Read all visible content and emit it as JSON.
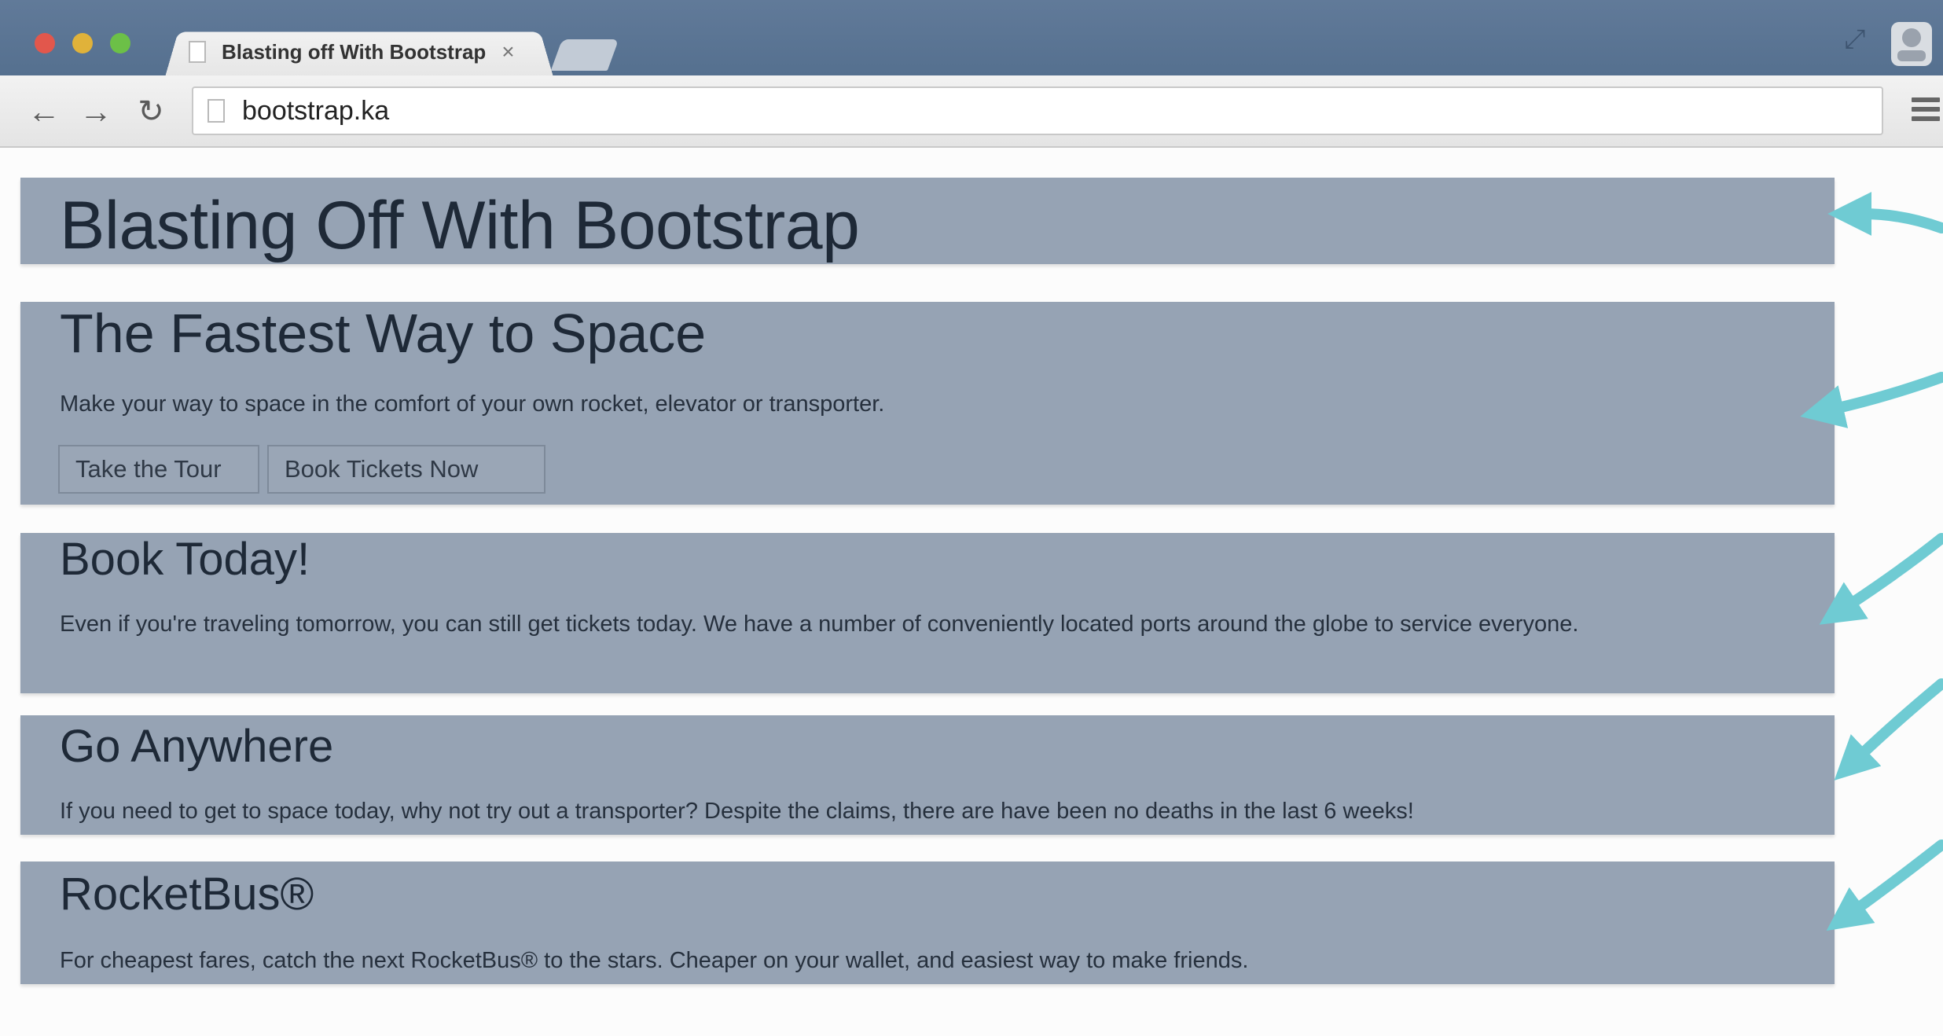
{
  "browser": {
    "tab_title": "Blasting off With Bootstrap",
    "tab_close": "×",
    "url": "bootstrap.ka",
    "icons": {
      "back": "back-arrow-icon",
      "forward": "forward-arrow-icon",
      "reload": "reload-icon",
      "menu": "hamburger-menu-icon",
      "expand": "expand-icon",
      "profile": "profile-icon"
    },
    "colors": {
      "tabbar": "#5c7594",
      "tab": "#ebebeb",
      "toolbar": "#ebebeb"
    }
  },
  "page": {
    "site_title": "Blasting Off With Bootstrap",
    "hero": {
      "heading": "The Fastest Way to Space",
      "text": "Make your way to space in the comfort of your own rocket, elevator or transporter.",
      "button_tour": "Take the Tour",
      "button_book": "Book Tickets Now"
    },
    "sections": [
      {
        "heading": "Book Today!",
        "text": "Even if you're traveling tomorrow, you can still get tickets today. We have a number of conveniently located ports around the globe to service everyone."
      },
      {
        "heading": "Go Anywhere",
        "text": "If you need to get to space today, why not try out a transporter? Despite the claims, there are have been no deaths in the last 6 weeks!"
      },
      {
        "heading": "RocketBus®",
        "text": "For cheapest fares, catch the next RocketBus® to the stars. Cheaper on your wallet, and easiest way to make friends."
      }
    ],
    "colors": {
      "box": "#96a3b4",
      "arrow": "#6fcbd3",
      "text": "#1e2937"
    }
  }
}
